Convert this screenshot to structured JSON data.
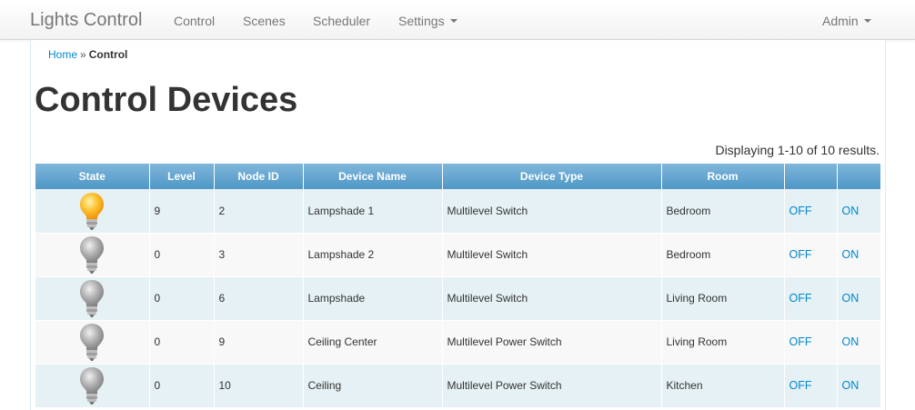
{
  "navbar": {
    "brand": "Lights Control",
    "items": [
      {
        "label": "Control"
      },
      {
        "label": "Scenes"
      },
      {
        "label": "Scheduler"
      },
      {
        "label": "Settings"
      }
    ],
    "user_menu": "Admin"
  },
  "breadcrumb": {
    "home": "Home",
    "separator": "»",
    "current": "Control"
  },
  "page": {
    "title": "Control Devices",
    "summary": "Displaying 1-10 of 10 results."
  },
  "table": {
    "headers": [
      "State",
      "Level",
      "Node ID",
      "Device Name",
      "Device Type",
      "Room",
      "",
      ""
    ],
    "rows": [
      {
        "state": "on",
        "level": "9",
        "node_id": "2",
        "name": "Lampshade 1",
        "type": "Multilevel Switch",
        "room": "Bedroom",
        "off": "OFF",
        "on": "ON"
      },
      {
        "state": "off",
        "level": "0",
        "node_id": "3",
        "name": "Lampshade 2",
        "type": "Multilevel Switch",
        "room": "Bedroom",
        "off": "OFF",
        "on": "ON"
      },
      {
        "state": "off",
        "level": "0",
        "node_id": "6",
        "name": "Lampshade",
        "type": "Multilevel Switch",
        "room": "Living Room",
        "off": "OFF",
        "on": "ON"
      },
      {
        "state": "off",
        "level": "0",
        "node_id": "9",
        "name": "Ceiling Center",
        "type": "Multilevel Power Switch",
        "room": "Living Room",
        "off": "OFF",
        "on": "ON"
      },
      {
        "state": "off",
        "level": "0",
        "node_id": "10",
        "name": "Ceiling",
        "type": "Multilevel Power Switch",
        "room": "Kitchen",
        "off": "OFF",
        "on": "ON"
      }
    ]
  },
  "colors": {
    "link": "#0088cc",
    "header_gradient_top": "#7fb6db",
    "header_gradient_bottom": "#4f97c6",
    "row_odd": "#e5f1f4",
    "row_even": "#f8f8f8",
    "bulb_on": "#f7a21b",
    "bulb_off": "#9a9a9a"
  },
  "icons": {
    "bulb_on": "lightbulb-on-icon",
    "bulb_off": "lightbulb-off-icon",
    "dropdown": "caret-down-icon"
  }
}
